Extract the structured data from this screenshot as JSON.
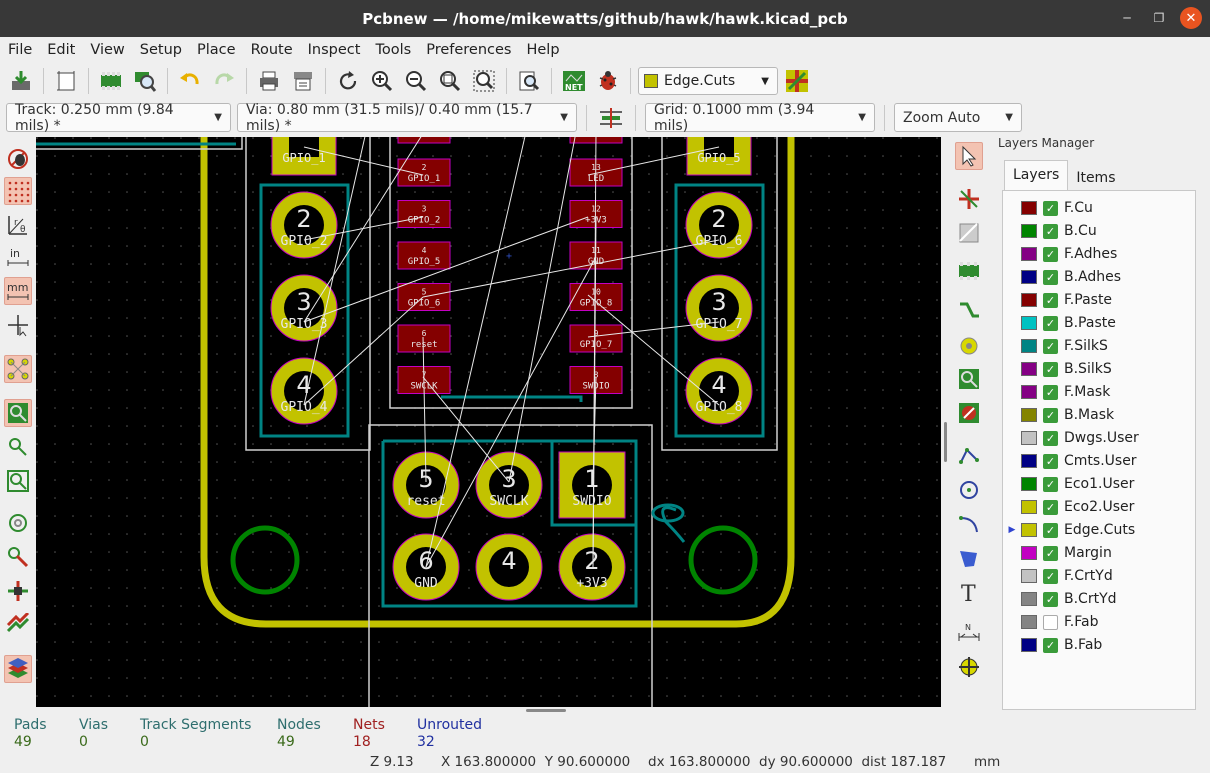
{
  "window": {
    "title": "Pcbnew — /home/mikewatts/github/hawk/hawk.kicad_pcb"
  },
  "menu": [
    "File",
    "Edit",
    "View",
    "Setup",
    "Place",
    "Route",
    "Inspect",
    "Tools",
    "Preferences",
    "Help"
  ],
  "toolbar": {
    "active_layer": "Edge.Cuts",
    "active_layer_color": "#c2c200",
    "track": "Track: 0.250 mm (9.84 mils) *",
    "via": "Via: 0.80 mm (31.5 mils)/ 0.40 mm (15.7 mils) *",
    "grid": "Grid: 0.1000 mm (3.94 mils)",
    "zoom": "Zoom Auto"
  },
  "layers_manager": {
    "title": "Layers Manager",
    "tabs": [
      "Layers",
      "Items"
    ],
    "active_tab": "Layers",
    "layers": [
      {
        "name": "F.Cu",
        "color": "#840000",
        "visible": true
      },
      {
        "name": "B.Cu",
        "color": "#008400",
        "visible": true
      },
      {
        "name": "F.Adhes",
        "color": "#840084",
        "visible": true
      },
      {
        "name": "B.Adhes",
        "color": "#000084",
        "visible": true
      },
      {
        "name": "F.Paste",
        "color": "#840000",
        "visible": true
      },
      {
        "name": "B.Paste",
        "color": "#00c2c2",
        "visible": true
      },
      {
        "name": "F.SilkS",
        "color": "#008484",
        "visible": true
      },
      {
        "name": "B.SilkS",
        "color": "#840084",
        "visible": true
      },
      {
        "name": "F.Mask",
        "color": "#840084",
        "visible": true
      },
      {
        "name": "B.Mask",
        "color": "#848400",
        "visible": true
      },
      {
        "name": "Dwgs.User",
        "color": "#c2c2c2",
        "visible": true
      },
      {
        "name": "Cmts.User",
        "color": "#000084",
        "visible": true
      },
      {
        "name": "Eco1.User",
        "color": "#008400",
        "visible": true
      },
      {
        "name": "Eco2.User",
        "color": "#c2c200",
        "visible": true
      },
      {
        "name": "Edge.Cuts",
        "color": "#c2c200",
        "visible": true,
        "active": true
      },
      {
        "name": "Margin",
        "color": "#c200c2",
        "visible": true
      },
      {
        "name": "F.CrtYd",
        "color": "#c2c2c2",
        "visible": true
      },
      {
        "name": "B.CrtYd",
        "color": "#848484",
        "visible": true
      },
      {
        "name": "F.Fab",
        "color": "#848484",
        "visible": false
      },
      {
        "name": "B.Fab",
        "color": "#000084",
        "visible": true
      }
    ]
  },
  "status": {
    "pads": {
      "label": "Pads",
      "value": "49"
    },
    "vias": {
      "label": "Vias",
      "value": "0"
    },
    "tracks": {
      "label": "Track Segments",
      "value": "0"
    },
    "nodes": {
      "label": "Nodes",
      "value": "49"
    },
    "nets": {
      "label": "Nets",
      "value": "18"
    },
    "unrouted": {
      "label": "Unrouted",
      "value": "32"
    },
    "zoom": "Z 9.13",
    "xy": "X 163.800000  Y 90.600000",
    "dxy": "dx 163.800000  dy 90.600000  dist 187.187",
    "units": "mm"
  },
  "pcb": {
    "left_header": [
      {
        "num": "2",
        "label": "GPIO_2"
      },
      {
        "num": "3",
        "label": "GPIO_3"
      },
      {
        "num": "4",
        "label": "GPIO_4"
      }
    ],
    "left_top_label": "GPIO_1",
    "right_header": [
      {
        "num": "2",
        "label": "GPIO_6"
      },
      {
        "num": "3",
        "label": "GPIO_7"
      },
      {
        "num": "4",
        "label": "GPIO_8"
      }
    ],
    "right_top_label": "GPIO_5",
    "ic_left_pads": [
      {
        "num": "2",
        "label": "GPIO_1"
      },
      {
        "num": "3",
        "label": "GPIO_2"
      },
      {
        "num": "4",
        "label": "GPIO_5"
      },
      {
        "num": "5",
        "label": "GPIO_6"
      },
      {
        "num": "6",
        "label": "reset"
      },
      {
        "num": "7",
        "label": "SWCLK"
      }
    ],
    "ic_right_pads": [
      {
        "num": "13",
        "label": "LED"
      },
      {
        "num": "12",
        "label": "+3V3"
      },
      {
        "num": "11",
        "label": "GND"
      },
      {
        "num": "10",
        "label": "GPIO_8"
      },
      {
        "num": "9",
        "label": "GPIO_7"
      },
      {
        "num": "8",
        "label": "SWDIO"
      }
    ],
    "swd_top": [
      {
        "num": "5",
        "label": "reset"
      },
      {
        "num": "3",
        "label": "SWCLK"
      },
      {
        "num": "1",
        "label": "SWDIO"
      }
    ],
    "swd_bottom": [
      {
        "num": "6",
        "label": "GND"
      },
      {
        "num": "4",
        "label": ""
      },
      {
        "num": "2",
        "label": "+3V3"
      }
    ]
  }
}
